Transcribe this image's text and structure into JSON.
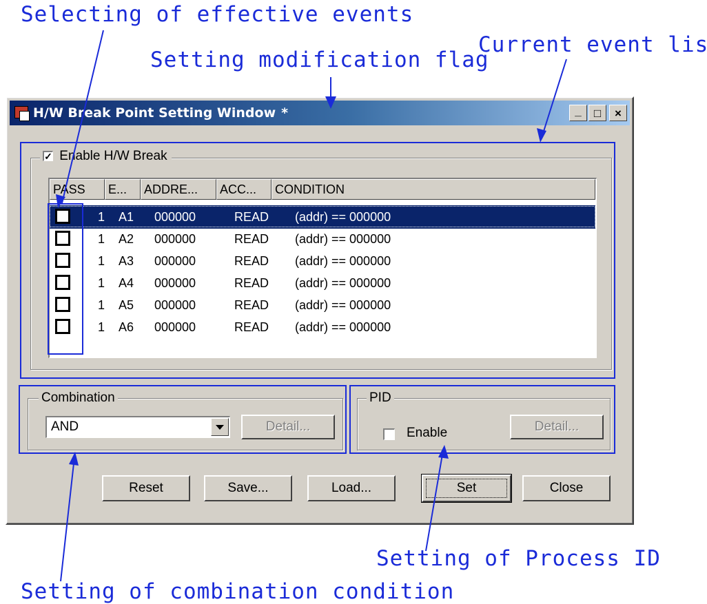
{
  "annotations": {
    "effective_events": "Selecting of effective events",
    "modification_flag": "Setting modification flag",
    "event_list": "Current event list",
    "process_id": "Setting of Process ID",
    "combination": "Setting of combination condition"
  },
  "window": {
    "title": "H/W Break Point Setting Window",
    "modified_flag": "*",
    "minimize": "_",
    "maximize": "□",
    "close": "×"
  },
  "enable_group": {
    "checked": true,
    "label": "Enable H/W Break"
  },
  "list": {
    "columns": [
      "PASS",
      "E...",
      "ADDRE...",
      "ACC...",
      "CONDITION"
    ],
    "rows": [
      {
        "pass": "1",
        "event": "A1",
        "address": "000000",
        "access": "READ",
        "condition": "(addr) == 000000",
        "enabled": false
      },
      {
        "pass": "1",
        "event": "A2",
        "address": "000000",
        "access": "READ",
        "condition": "(addr) == 000000",
        "enabled": false
      },
      {
        "pass": "1",
        "event": "A3",
        "address": "000000",
        "access": "READ",
        "condition": "(addr) == 000000",
        "enabled": false
      },
      {
        "pass": "1",
        "event": "A4",
        "address": "000000",
        "access": "READ",
        "condition": "(addr) == 000000",
        "enabled": false
      },
      {
        "pass": "1",
        "event": "A5",
        "address": "000000",
        "access": "READ",
        "condition": "(addr) == 000000",
        "enabled": false
      },
      {
        "pass": "1",
        "event": "A6",
        "address": "000000",
        "access": "READ",
        "condition": "(addr) == 000000",
        "enabled": false
      }
    ],
    "selected_row": 0
  },
  "combination": {
    "label": "Combination",
    "value": "AND",
    "detail_label": "Detail..."
  },
  "pid": {
    "label": "PID",
    "enable_label": "Enable",
    "enable_checked": false,
    "detail_label": "Detail..."
  },
  "buttons": {
    "reset": "Reset",
    "save": "Save...",
    "load": "Load...",
    "set": "Set",
    "close": "Close"
  },
  "colors": {
    "annotation": "#1a2bd8",
    "title_active": "#0a246a",
    "selection": "#0a246a",
    "face": "#d4d0c8"
  }
}
